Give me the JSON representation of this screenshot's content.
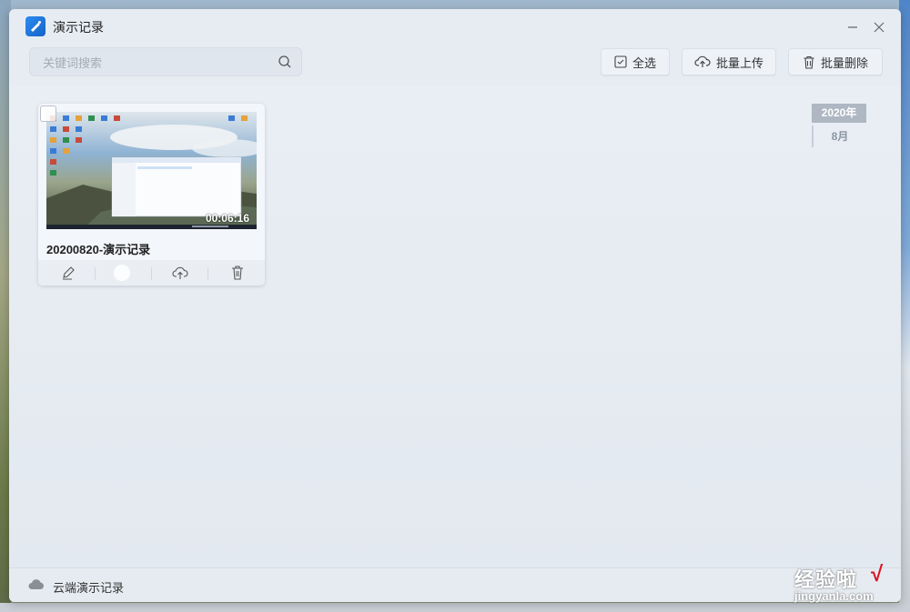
{
  "window": {
    "title": "演示记录"
  },
  "search": {
    "placeholder": "关键词搜索",
    "value": ""
  },
  "toolbar": {
    "select_all": "全选",
    "batch_upload": "批量上传",
    "batch_delete": "批量删除"
  },
  "recordings": [
    {
      "name": "20200820-演示记录",
      "duration": "00:06:16",
      "selected": false
    }
  ],
  "timeline": {
    "year": "2020年",
    "month": "8月"
  },
  "footer": {
    "label": "云端演示记录"
  },
  "watermark": {
    "text_cn": "经验啦",
    "text_en": "jingyanla.com",
    "check": "√"
  },
  "colors": {
    "accent": "#2d8cf0",
    "window_bg": "#e7ecf3"
  }
}
